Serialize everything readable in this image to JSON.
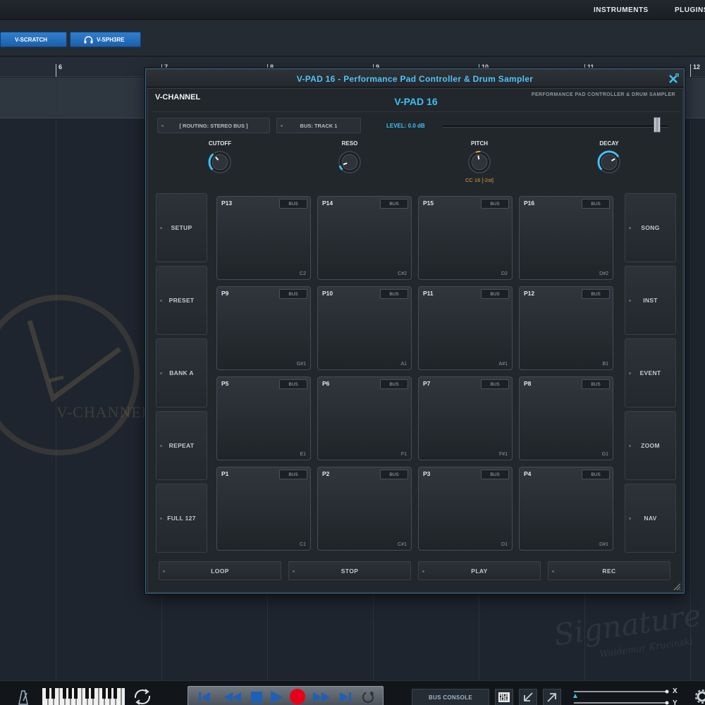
{
  "menubar": {
    "items": [
      "INSTRUMENTS",
      "PLUGINS"
    ]
  },
  "tracks": {
    "tabs": [
      {
        "label": "V-SCRATCH"
      },
      {
        "label": "V-SPH3RE"
      }
    ]
  },
  "ruler": {
    "marks": [
      "6",
      "7",
      "8",
      "9",
      "10",
      "11",
      "12"
    ]
  },
  "watermark": {
    "logo_text": "V-CHANNEL",
    "signature": "Signature",
    "signature_sub": "Waldemar Krucinski"
  },
  "window": {
    "title": "V-PAD 16 - Performance Pad Controller & Drum Sampler",
    "brand": "V-CHANNEL",
    "product": "V-PAD 16",
    "subtitle": "PERFORMANCE PAD CONTROLLER & DRUM SAMPLER",
    "routing": "[ ROUTING: STEREO BUS ]",
    "bus": "BUS: TRACK 1",
    "level": "LEVEL: 0.0 dB",
    "level_value": 0.95
  },
  "knobs": [
    {
      "label": "CUTOFF",
      "angle": -40,
      "sub": ""
    },
    {
      "label": "RESO",
      "angle": -110,
      "sub": ""
    },
    {
      "label": "PITCH",
      "angle": -10,
      "sub": "CC 16 [-2st]"
    },
    {
      "label": "DECAY",
      "angle": 60,
      "sub": ""
    }
  ],
  "left_buttons": [
    "SETUP",
    "PRESET",
    "BANK A",
    "REPEAT",
    "FULL 127"
  ],
  "right_buttons": [
    "SONG",
    "INST",
    "EVENT",
    "ZOOM",
    "NAV"
  ],
  "pads": [
    [
      {
        "id": "P13",
        "note": "C2"
      },
      {
        "id": "P14",
        "note": "C#2"
      },
      {
        "id": "P15",
        "note": "D2"
      },
      {
        "id": "P16",
        "note": "D#2"
      }
    ],
    [
      {
        "id": "P9",
        "note": "G#1"
      },
      {
        "id": "P10",
        "note": "A1"
      },
      {
        "id": "P11",
        "note": "A#1"
      },
      {
        "id": "P12",
        "note": "B1"
      }
    ],
    [
      {
        "id": "P5",
        "note": "E1"
      },
      {
        "id": "P6",
        "note": "F1"
      },
      {
        "id": "P7",
        "note": "F#1"
      },
      {
        "id": "P8",
        "note": "G1"
      }
    ],
    [
      {
        "id": "P1",
        "note": "C1"
      },
      {
        "id": "P2",
        "note": "C#1"
      },
      {
        "id": "P3",
        "note": "D1"
      },
      {
        "id": "P4",
        "note": "D#1"
      }
    ]
  ],
  "pad_bus_label": "BUS",
  "performance_buttons": [
    "LOOP",
    "STOP",
    "PLAY",
    "REC"
  ],
  "bottombar": {
    "bus_console": "BUS CONSOLE",
    "x_label": "X",
    "y_label": "Y"
  },
  "colors": {
    "accent": "#3fc0f0",
    "tab_blue": "#2a74c4",
    "record": "#e8001a",
    "pitch_sub": "#e0a030"
  }
}
